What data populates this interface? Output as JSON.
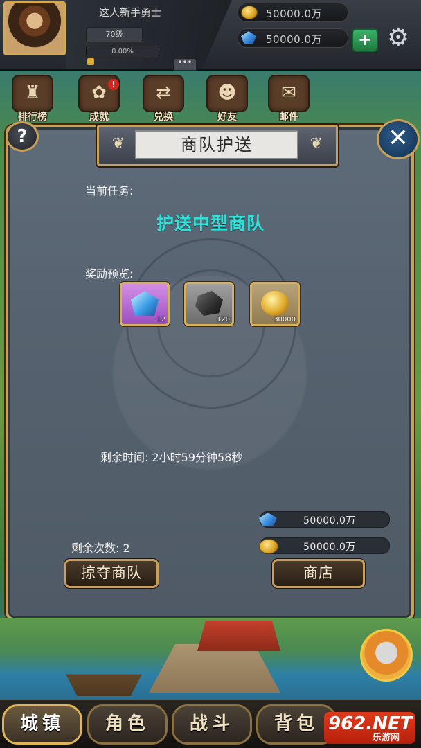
{
  "player": {
    "name": "这人新手勇士",
    "level": "70级",
    "exp": "0.00%",
    "exp_fraction": 0.0
  },
  "currency": {
    "gold": "50000.0万",
    "diamond": "50000.0万",
    "plus": "+"
  },
  "chat": {
    "label": "•••"
  },
  "nav": [
    {
      "label": "排行榜",
      "icon": "ranking-icon",
      "glyph": "♜"
    },
    {
      "label": "成就",
      "icon": "achievement-icon",
      "glyph": "✿",
      "badge": "!"
    },
    {
      "label": "兑换",
      "icon": "exchange-icon",
      "glyph": "⇄"
    },
    {
      "label": "好友",
      "icon": "friends-icon",
      "glyph": "☻"
    },
    {
      "label": "邮件",
      "icon": "mail-icon",
      "glyph": "✉"
    }
  ],
  "dialog": {
    "title": "商队护送",
    "help": "?",
    "close": "✕",
    "current_task_label": "当前任务:",
    "task_name": "护送中型商队",
    "reward_label": "奖励预览:",
    "rewards": [
      {
        "icon": "blue-crystal-icon",
        "qty": "12"
      },
      {
        "icon": "iron-ore-icon",
        "qty": "120"
      },
      {
        "icon": "gold-coin-stack-icon",
        "qty": "30000"
      }
    ],
    "time_left": "剩余时间:  2小时59分钟58秒",
    "diamond_balance": "50000.0万",
    "gold_balance": "50000.0万",
    "remaining_attempts": "剩余次数:  2",
    "plunder_button": "掠夺商队",
    "shop_button": "商店"
  },
  "tabs": [
    {
      "label": "城镇",
      "active": true
    },
    {
      "label": "角色",
      "active": false
    },
    {
      "label": "战斗",
      "active": false
    },
    {
      "label": "背包",
      "active": false
    }
  ],
  "watermark": {
    "big": "962.NET",
    "small": "乐游网"
  },
  "colors": {
    "gold_border": "#c9a05a",
    "task_name": "#2fe0d8",
    "badge_red": "#d8241f"
  }
}
